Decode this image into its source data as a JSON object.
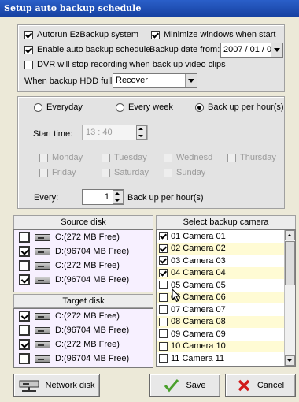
{
  "window": {
    "title": "Setup auto backup schedule"
  },
  "options": {
    "autorun_label": "Autorun EzBackup system",
    "autorun_checked": true,
    "minimize_label": "Minimize windows when start",
    "minimize_checked": true,
    "enable_label": "Enable auto backup schedule",
    "enable_checked": true,
    "backup_date_label": "Backup date from:",
    "backup_date_value": "2007 / 01 / 02",
    "dvr_label": "DVR will stop recording when back up video clips",
    "dvr_checked": false,
    "hdd_full_label": "When backup HDD full:",
    "hdd_full_value": "Recover"
  },
  "schedule": {
    "modes": [
      "Everyday",
      "Every week",
      "Back up per hour(s)"
    ],
    "selected_mode": "Back up per hour(s)",
    "start_time_label": "Start time:",
    "start_time_value": "13 : 40",
    "days": [
      "Monday",
      "Tuesday",
      "Wednesd",
      "Thursday",
      "Friday",
      "Saturday",
      "Sunday"
    ],
    "every_label": "Every:",
    "every_value": "1",
    "every_suffix": "Back up per  hour(s)"
  },
  "source_disk": {
    "header": "Source disk",
    "items": [
      {
        "label": "C:(272 MB Free)",
        "checked": false
      },
      {
        "label": "D:(96704 MB Free)",
        "checked": true
      },
      {
        "label": "C:(272 MB Free)",
        "checked": false
      },
      {
        "label": "D:(96704 MB Free)",
        "checked": true
      }
    ]
  },
  "target_disk": {
    "header": "Target disk",
    "items": [
      {
        "label": "C:(272 MB Free)",
        "checked": true
      },
      {
        "label": "D:(96704 MB Free)",
        "checked": false
      },
      {
        "label": "C:(272 MB Free)",
        "checked": true
      },
      {
        "label": "D:(96704 MB Free)",
        "checked": false
      }
    ]
  },
  "cameras": {
    "header": "Select backup camera",
    "items": [
      {
        "label": "01 Camera 01",
        "checked": true
      },
      {
        "label": "02 Camera 02",
        "checked": true
      },
      {
        "label": "03 Camera 03",
        "checked": true
      },
      {
        "label": "04 Camera 04",
        "checked": true
      },
      {
        "label": "05 Camera 05",
        "checked": false
      },
      {
        "label": "06 Camera 06",
        "checked": false
      },
      {
        "label": "07 Camera 07",
        "checked": false
      },
      {
        "label": "08 Camera 08",
        "checked": false
      },
      {
        "label": "09 Camera 09",
        "checked": false
      },
      {
        "label": "10 Camera 10",
        "checked": false
      },
      {
        "label": "11 Camera 11",
        "checked": false
      }
    ]
  },
  "buttons": {
    "network": "Network disk",
    "save": "Save",
    "cancel": "Cancel"
  },
  "colors": {
    "title_bar": "#1f4fb5",
    "disk_list_bg": "#f7f0ff",
    "camera_alt_row": "#fffbd4",
    "save_check": "#4aa02c",
    "cancel_x": "#d11a1a"
  }
}
